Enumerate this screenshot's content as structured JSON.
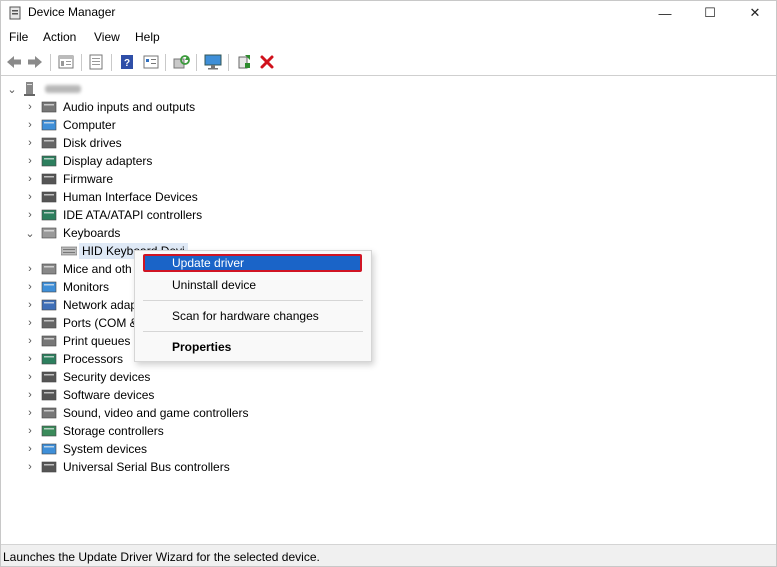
{
  "window": {
    "title": "Device Manager"
  },
  "window_controls": {
    "minimize": "—",
    "maximize": "☐",
    "close": "✕"
  },
  "menubar": {
    "items": [
      "File",
      "Action",
      "View",
      "Help"
    ]
  },
  "toolbar": {
    "buttons": [
      "back-arrow-icon",
      "forward-arrow-icon",
      "properties-sheet-icon",
      "device-view-icon",
      "help-icon",
      "properties-icon",
      "scan-hardware-icon",
      "monitor-icon",
      "update-driver-icon",
      "uninstall-icon"
    ]
  },
  "tree": {
    "root_label": "",
    "categories": [
      {
        "label": "Audio inputs and outputs",
        "icon": "speaker-icon",
        "expanded": false
      },
      {
        "label": "Computer",
        "icon": "computer-icon",
        "expanded": false
      },
      {
        "label": "Disk drives",
        "icon": "disk-drive-icon",
        "expanded": false
      },
      {
        "label": "Display adapters",
        "icon": "display-adapter-icon",
        "expanded": false
      },
      {
        "label": "Firmware",
        "icon": "firmware-icon",
        "expanded": false
      },
      {
        "label": "Human Interface Devices",
        "icon": "hid-icon",
        "expanded": false
      },
      {
        "label": "IDE ATA/ATAPI controllers",
        "icon": "ide-controller-icon",
        "expanded": false
      },
      {
        "label": "Keyboards",
        "icon": "keyboard-icon",
        "expanded": true
      },
      {
        "label": "Mice and oth",
        "icon": "mouse-icon",
        "expanded": false
      },
      {
        "label": "Monitors",
        "icon": "monitor-icon",
        "expanded": false
      },
      {
        "label": "Network adap",
        "icon": "network-adapter-icon",
        "expanded": false
      },
      {
        "label": "Ports (COM &",
        "icon": "port-icon",
        "expanded": false
      },
      {
        "label": "Print queues",
        "icon": "printer-icon",
        "expanded": false
      },
      {
        "label": "Processors",
        "icon": "processor-icon",
        "expanded": false
      },
      {
        "label": "Security devices",
        "icon": "security-device-icon",
        "expanded": false
      },
      {
        "label": "Software devices",
        "icon": "software-device-icon",
        "expanded": false
      },
      {
        "label": "Sound, video and game controllers",
        "icon": "sound-icon",
        "expanded": false
      },
      {
        "label": "Storage controllers",
        "icon": "storage-controller-icon",
        "expanded": false
      },
      {
        "label": "System devices",
        "icon": "system-device-icon",
        "expanded": false
      },
      {
        "label": "Universal Serial Bus controllers",
        "icon": "usb-icon",
        "expanded": false
      }
    ],
    "keyboard_child": {
      "label": "HID Keyboard Devi",
      "icon": "keyboard-icon"
    }
  },
  "context_menu": {
    "items": [
      "Update driver",
      "Uninstall device",
      "Scan for hardware changes",
      "Properties"
    ],
    "highlighted": "Update driver",
    "bold": "Properties"
  },
  "statusbar": {
    "text": "Launches the Update Driver Wizard for the selected device."
  },
  "colors": {
    "highlight": "#1a64c8",
    "annotation_border": "#d01424",
    "close_icon": "#d0121c"
  }
}
